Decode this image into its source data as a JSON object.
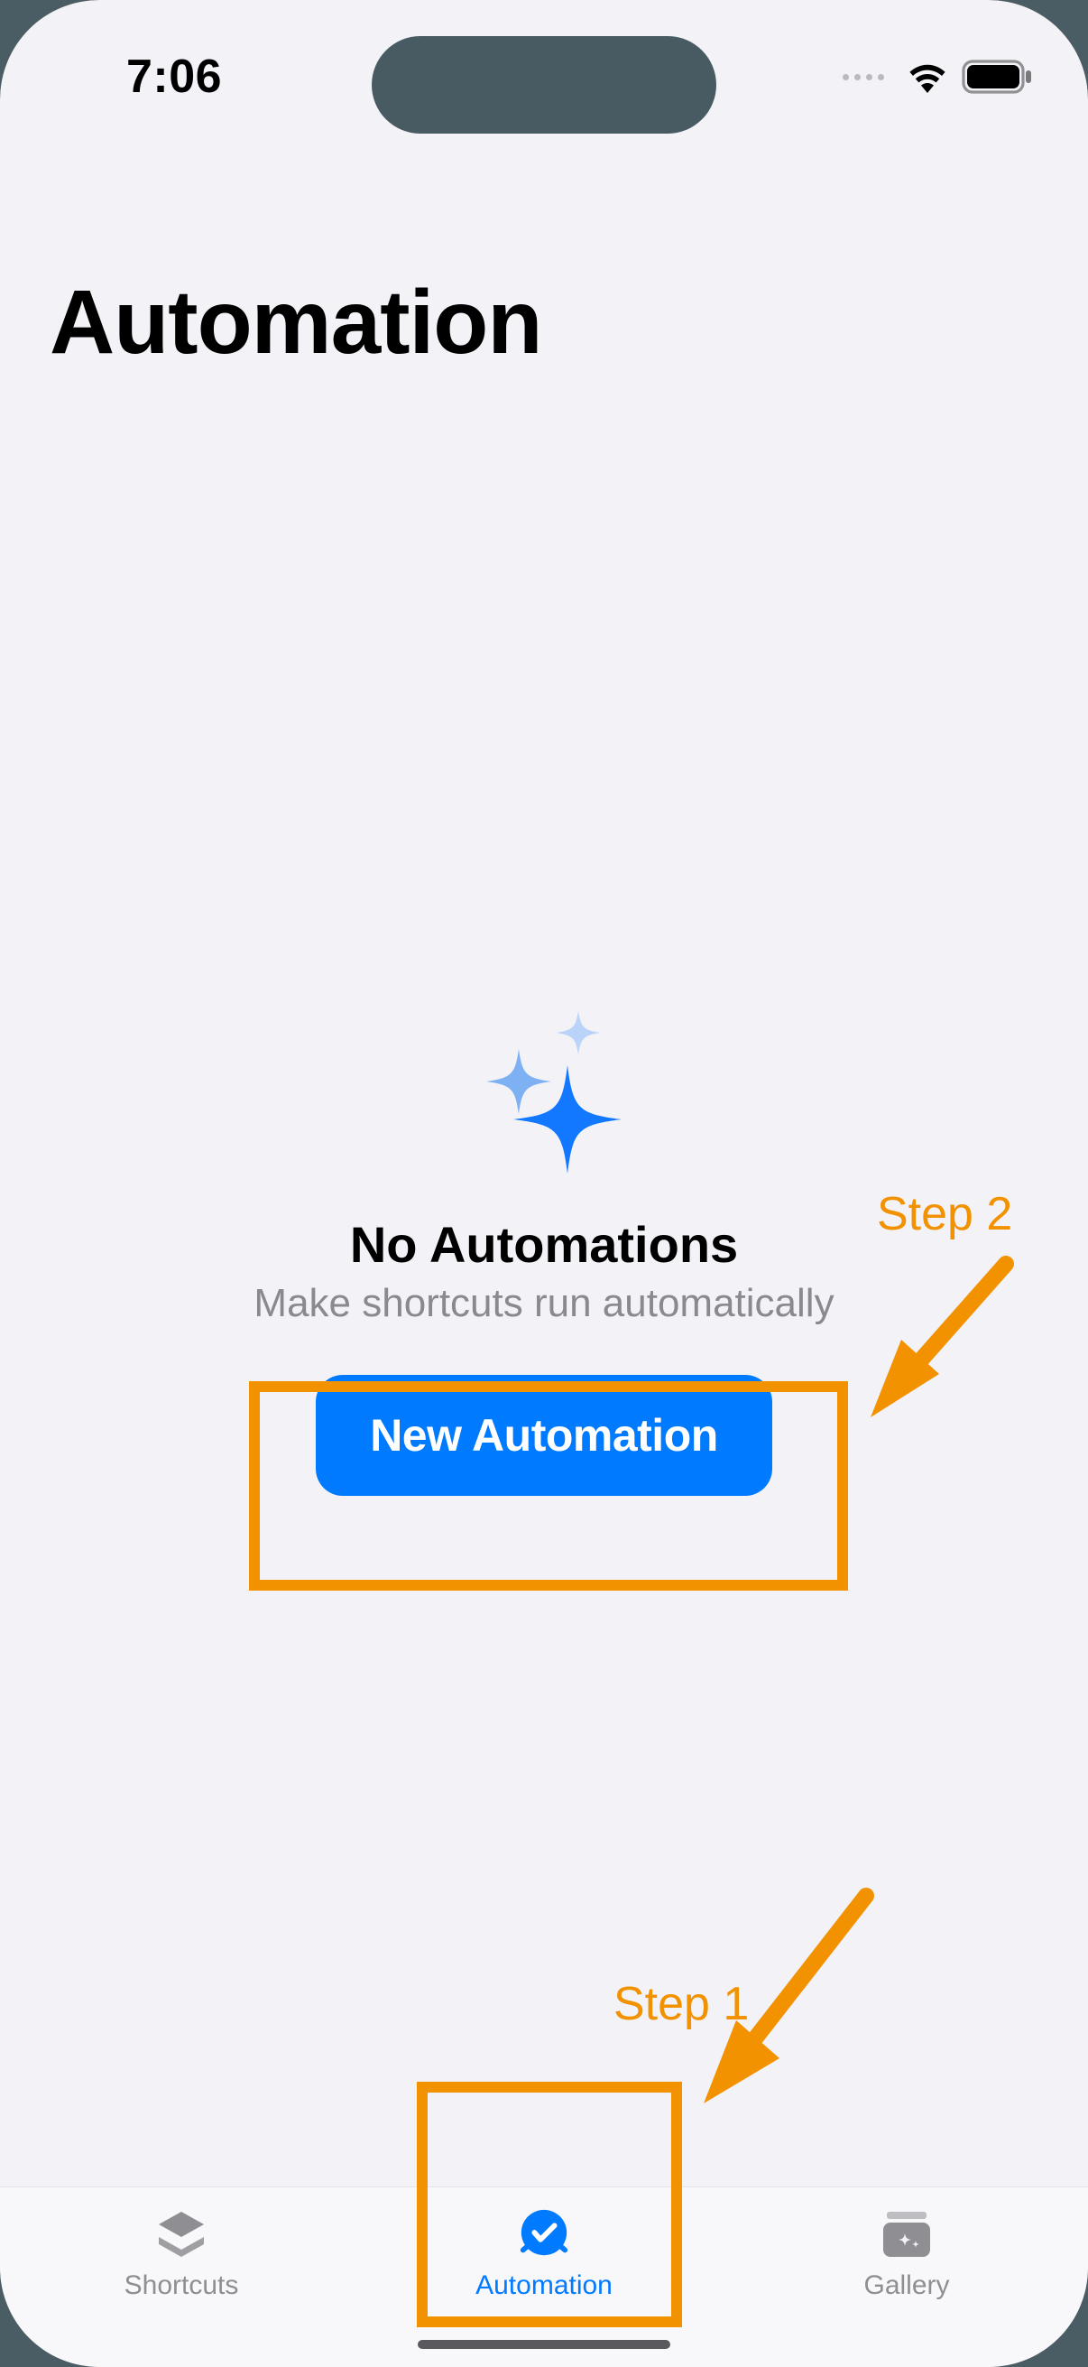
{
  "status_bar": {
    "time": "7:06"
  },
  "page": {
    "title": "Automation"
  },
  "empty_state": {
    "title": "No Automations",
    "subtitle": "Make shortcuts run automatically",
    "button_label": "New Automation"
  },
  "tab_bar": {
    "shortcuts": {
      "label": "Shortcuts"
    },
    "automation": {
      "label": "Automation"
    },
    "gallery": {
      "label": "Gallery"
    }
  },
  "annotations": {
    "step1": "Step 1",
    "step2": "Step 2"
  },
  "colors": {
    "accent": "#007aff",
    "annotation": "#f39200",
    "bg": "#f2f2f7",
    "text_secondary": "#8a8a8e"
  }
}
